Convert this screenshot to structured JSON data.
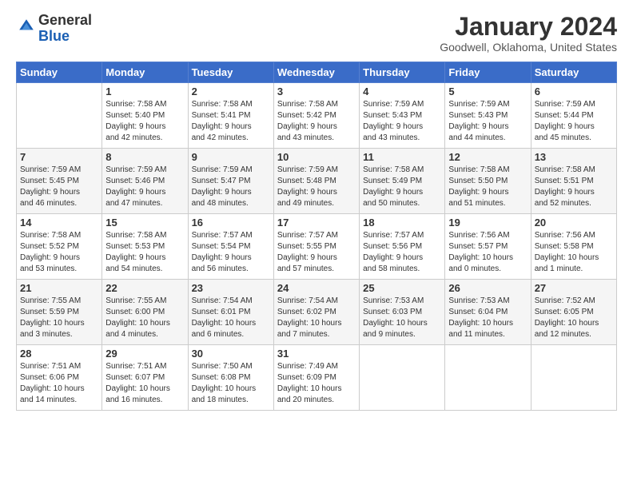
{
  "logo": {
    "line1": "General",
    "line2": "Blue"
  },
  "title": "January 2024",
  "location": "Goodwell, Oklahoma, United States",
  "headers": [
    "Sunday",
    "Monday",
    "Tuesday",
    "Wednesday",
    "Thursday",
    "Friday",
    "Saturday"
  ],
  "weeks": [
    [
      {
        "day": "",
        "lines": []
      },
      {
        "day": "1",
        "lines": [
          "Sunrise: 7:58 AM",
          "Sunset: 5:40 PM",
          "Daylight: 9 hours",
          "and 42 minutes."
        ]
      },
      {
        "day": "2",
        "lines": [
          "Sunrise: 7:58 AM",
          "Sunset: 5:41 PM",
          "Daylight: 9 hours",
          "and 42 minutes."
        ]
      },
      {
        "day": "3",
        "lines": [
          "Sunrise: 7:58 AM",
          "Sunset: 5:42 PM",
          "Daylight: 9 hours",
          "and 43 minutes."
        ]
      },
      {
        "day": "4",
        "lines": [
          "Sunrise: 7:59 AM",
          "Sunset: 5:43 PM",
          "Daylight: 9 hours",
          "and 43 minutes."
        ]
      },
      {
        "day": "5",
        "lines": [
          "Sunrise: 7:59 AM",
          "Sunset: 5:43 PM",
          "Daylight: 9 hours",
          "and 44 minutes."
        ]
      },
      {
        "day": "6",
        "lines": [
          "Sunrise: 7:59 AM",
          "Sunset: 5:44 PM",
          "Daylight: 9 hours",
          "and 45 minutes."
        ]
      }
    ],
    [
      {
        "day": "7",
        "lines": [
          "Sunrise: 7:59 AM",
          "Sunset: 5:45 PM",
          "Daylight: 9 hours",
          "and 46 minutes."
        ]
      },
      {
        "day": "8",
        "lines": [
          "Sunrise: 7:59 AM",
          "Sunset: 5:46 PM",
          "Daylight: 9 hours",
          "and 47 minutes."
        ]
      },
      {
        "day": "9",
        "lines": [
          "Sunrise: 7:59 AM",
          "Sunset: 5:47 PM",
          "Daylight: 9 hours",
          "and 48 minutes."
        ]
      },
      {
        "day": "10",
        "lines": [
          "Sunrise: 7:59 AM",
          "Sunset: 5:48 PM",
          "Daylight: 9 hours",
          "and 49 minutes."
        ]
      },
      {
        "day": "11",
        "lines": [
          "Sunrise: 7:58 AM",
          "Sunset: 5:49 PM",
          "Daylight: 9 hours",
          "and 50 minutes."
        ]
      },
      {
        "day": "12",
        "lines": [
          "Sunrise: 7:58 AM",
          "Sunset: 5:50 PM",
          "Daylight: 9 hours",
          "and 51 minutes."
        ]
      },
      {
        "day": "13",
        "lines": [
          "Sunrise: 7:58 AM",
          "Sunset: 5:51 PM",
          "Daylight: 9 hours",
          "and 52 minutes."
        ]
      }
    ],
    [
      {
        "day": "14",
        "lines": [
          "Sunrise: 7:58 AM",
          "Sunset: 5:52 PM",
          "Daylight: 9 hours",
          "and 53 minutes."
        ]
      },
      {
        "day": "15",
        "lines": [
          "Sunrise: 7:58 AM",
          "Sunset: 5:53 PM",
          "Daylight: 9 hours",
          "and 54 minutes."
        ]
      },
      {
        "day": "16",
        "lines": [
          "Sunrise: 7:57 AM",
          "Sunset: 5:54 PM",
          "Daylight: 9 hours",
          "and 56 minutes."
        ]
      },
      {
        "day": "17",
        "lines": [
          "Sunrise: 7:57 AM",
          "Sunset: 5:55 PM",
          "Daylight: 9 hours",
          "and 57 minutes."
        ]
      },
      {
        "day": "18",
        "lines": [
          "Sunrise: 7:57 AM",
          "Sunset: 5:56 PM",
          "Daylight: 9 hours",
          "and 58 minutes."
        ]
      },
      {
        "day": "19",
        "lines": [
          "Sunrise: 7:56 AM",
          "Sunset: 5:57 PM",
          "Daylight: 10 hours",
          "and 0 minutes."
        ]
      },
      {
        "day": "20",
        "lines": [
          "Sunrise: 7:56 AM",
          "Sunset: 5:58 PM",
          "Daylight: 10 hours",
          "and 1 minute."
        ]
      }
    ],
    [
      {
        "day": "21",
        "lines": [
          "Sunrise: 7:55 AM",
          "Sunset: 5:59 PM",
          "Daylight: 10 hours",
          "and 3 minutes."
        ]
      },
      {
        "day": "22",
        "lines": [
          "Sunrise: 7:55 AM",
          "Sunset: 6:00 PM",
          "Daylight: 10 hours",
          "and 4 minutes."
        ]
      },
      {
        "day": "23",
        "lines": [
          "Sunrise: 7:54 AM",
          "Sunset: 6:01 PM",
          "Daylight: 10 hours",
          "and 6 minutes."
        ]
      },
      {
        "day": "24",
        "lines": [
          "Sunrise: 7:54 AM",
          "Sunset: 6:02 PM",
          "Daylight: 10 hours",
          "and 7 minutes."
        ]
      },
      {
        "day": "25",
        "lines": [
          "Sunrise: 7:53 AM",
          "Sunset: 6:03 PM",
          "Daylight: 10 hours",
          "and 9 minutes."
        ]
      },
      {
        "day": "26",
        "lines": [
          "Sunrise: 7:53 AM",
          "Sunset: 6:04 PM",
          "Daylight: 10 hours",
          "and 11 minutes."
        ]
      },
      {
        "day": "27",
        "lines": [
          "Sunrise: 7:52 AM",
          "Sunset: 6:05 PM",
          "Daylight: 10 hours",
          "and 12 minutes."
        ]
      }
    ],
    [
      {
        "day": "28",
        "lines": [
          "Sunrise: 7:51 AM",
          "Sunset: 6:06 PM",
          "Daylight: 10 hours",
          "and 14 minutes."
        ]
      },
      {
        "day": "29",
        "lines": [
          "Sunrise: 7:51 AM",
          "Sunset: 6:07 PM",
          "Daylight: 10 hours",
          "and 16 minutes."
        ]
      },
      {
        "day": "30",
        "lines": [
          "Sunrise: 7:50 AM",
          "Sunset: 6:08 PM",
          "Daylight: 10 hours",
          "and 18 minutes."
        ]
      },
      {
        "day": "31",
        "lines": [
          "Sunrise: 7:49 AM",
          "Sunset: 6:09 PM",
          "Daylight: 10 hours",
          "and 20 minutes."
        ]
      },
      {
        "day": "",
        "lines": []
      },
      {
        "day": "",
        "lines": []
      },
      {
        "day": "",
        "lines": []
      }
    ]
  ]
}
